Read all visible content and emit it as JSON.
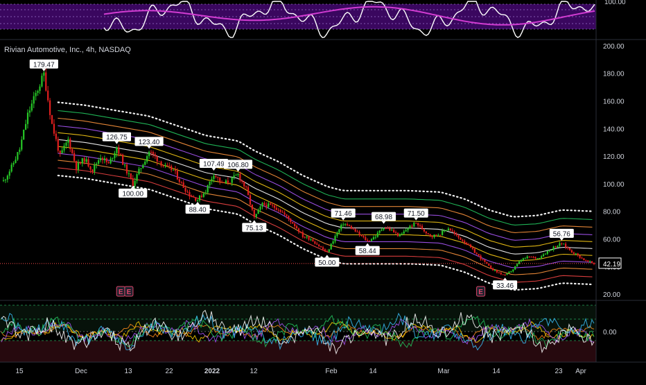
{
  "chart_title": "Rivian Automotive, Inc., 4h, NASDAQ",
  "colors": {
    "background": "#000000",
    "up": "#26c826",
    "down": "#e01e1e",
    "axis_text": "#d1d4dc",
    "price_line": "#ff4d4d",
    "oscillator_band": "#6a0dad",
    "oscillator_line": "#ffffff",
    "oscillator_signal": "#d23cd2",
    "envelope_colors": [
      "#ffffff",
      "#22c55e",
      "#fb923c",
      "#a855f7",
      "#facc15",
      "#ffffff",
      "#facc15",
      "#a855f7",
      "#fb923c",
      "#ef4444",
      "#ffffff"
    ]
  },
  "icons": {
    "earnings_marker": "earnings-e-icon"
  },
  "top_panel": {
    "label": "100.00"
  },
  "bottom_panel": {
    "label": "0.00"
  },
  "chart_data": {
    "type": "candlestick",
    "title": "Rivian Automotive, Inc., 4h, NASDAQ",
    "y_ticks": [
      20,
      40,
      60,
      80,
      100,
      120,
      140,
      160,
      180,
      200
    ],
    "y_tick_labels": [
      "20.00",
      "40.00",
      "60.00",
      "80.00",
      "100.00",
      "120.00",
      "140.00",
      "160.00",
      "180.00",
      "200.00"
    ],
    "ylim": [
      16,
      204
    ],
    "x_tick_labels": [
      "15",
      "Dec",
      "13",
      "22",
      "2022",
      "12",
      "Feb",
      "14",
      "Mar",
      "14",
      "23",
      "Apr"
    ],
    "last_price": "42.19",
    "close_path": [
      [
        0,
        102
      ],
      [
        4,
        112
      ],
      [
        8,
        125
      ],
      [
        12,
        150
      ],
      [
        16,
        165
      ],
      [
        20,
        179.47
      ],
      [
        24,
        143
      ],
      [
        28,
        120
      ],
      [
        32,
        132
      ],
      [
        36,
        112
      ],
      [
        40,
        118
      ],
      [
        44,
        110
      ],
      [
        48,
        120
      ],
      [
        52,
        114
      ],
      [
        56,
        126.75
      ],
      [
        60,
        112
      ],
      [
        64,
        100
      ],
      [
        68,
        112
      ],
      [
        72,
        123.4
      ],
      [
        76,
        118
      ],
      [
        80,
        112
      ],
      [
        84,
        110
      ],
      [
        88,
        100
      ],
      [
        92,
        92
      ],
      [
        96,
        88.4
      ],
      [
        100,
        95
      ],
      [
        104,
        107.49
      ],
      [
        108,
        100
      ],
      [
        112,
        102
      ],
      [
        116,
        106.8
      ],
      [
        120,
        96
      ],
      [
        124,
        75.13
      ],
      [
        128,
        85
      ],
      [
        132,
        84
      ],
      [
        136,
        82
      ],
      [
        140,
        76
      ],
      [
        144,
        70
      ],
      [
        148,
        62
      ],
      [
        152,
        60
      ],
      [
        156,
        55
      ],
      [
        160,
        50
      ],
      [
        164,
        62
      ],
      [
        168,
        71.46
      ],
      [
        172,
        68
      ],
      [
        176,
        63
      ],
      [
        180,
        58.44
      ],
      [
        184,
        62
      ],
      [
        188,
        68.98
      ],
      [
        192,
        66
      ],
      [
        196,
        62
      ],
      [
        200,
        68
      ],
      [
        204,
        71.5
      ],
      [
        208,
        66
      ],
      [
        212,
        62
      ],
      [
        216,
        64
      ],
      [
        220,
        68
      ],
      [
        224,
        62
      ],
      [
        228,
        58
      ],
      [
        232,
        52
      ],
      [
        236,
        46
      ],
      [
        240,
        40
      ],
      [
        244,
        36
      ],
      [
        248,
        33.46
      ],
      [
        252,
        38
      ],
      [
        256,
        45
      ],
      [
        260,
        47
      ],
      [
        264,
        46
      ],
      [
        268,
        50
      ],
      [
        272,
        54
      ],
      [
        276,
        56.76
      ],
      [
        280,
        52
      ],
      [
        284,
        48
      ],
      [
        288,
        44
      ],
      [
        292,
        42.19
      ]
    ],
    "labels": [
      {
        "text": "179.47",
        "i": 20,
        "price": 179.47,
        "pos": "above"
      },
      {
        "text": "126.75",
        "i": 56,
        "price": 126.75,
        "pos": "above"
      },
      {
        "text": "123.40",
        "i": 72,
        "price": 123.4,
        "pos": "above"
      },
      {
        "text": "100.00",
        "i": 64,
        "price": 100,
        "pos": "below"
      },
      {
        "text": "88.40",
        "i": 96,
        "price": 88.4,
        "pos": "below"
      },
      {
        "text": "107.49",
        "i": 104,
        "price": 107.49,
        "pos": "above"
      },
      {
        "text": "106.80",
        "i": 116,
        "price": 106.8,
        "pos": "above"
      },
      {
        "text": "75.13",
        "i": 124,
        "price": 75.13,
        "pos": "below"
      },
      {
        "text": "71.46",
        "i": 168,
        "price": 71.46,
        "pos": "above"
      },
      {
        "text": "50.00",
        "i": 160,
        "price": 50,
        "pos": "below"
      },
      {
        "text": "68.98",
        "i": 188,
        "price": 68.98,
        "pos": "above"
      },
      {
        "text": "58.44",
        "i": 180,
        "price": 58.44,
        "pos": "below"
      },
      {
        "text": "71.50",
        "i": 204,
        "price": 71.5,
        "pos": "above"
      },
      {
        "text": "33.46",
        "i": 248,
        "price": 33.46,
        "pos": "below"
      },
      {
        "text": "56.76",
        "i": 276,
        "price": 56.76,
        "pos": "above"
      }
    ],
    "envelope": {
      "center_path": [
        [
          0,
          0
        ],
        [
          10,
          0
        ],
        [
          20,
          0
        ],
        [
          27,
          128
        ],
        [
          40,
          126
        ],
        [
          56,
          122
        ],
        [
          72,
          118
        ],
        [
          84,
          112
        ],
        [
          100,
          104
        ],
        [
          116,
          100
        ],
        [
          124,
          93
        ],
        [
          136,
          85
        ],
        [
          148,
          75
        ],
        [
          160,
          67
        ],
        [
          168,
          64
        ],
        [
          200,
          64
        ],
        [
          216,
          63
        ],
        [
          228,
          58
        ],
        [
          240,
          50
        ],
        [
          252,
          45
        ],
        [
          264,
          46
        ],
        [
          276,
          50
        ],
        [
          292,
          49
        ]
      ],
      "offsets": [
        31,
        25,
        19.5,
        14,
        9,
        4,
        -1,
        -6,
        -11,
        -16.5,
        -22
      ]
    },
    "earnings_markers": [
      {
        "i": 58,
        "label": "E"
      },
      {
        "i": 62,
        "label": "E"
      },
      {
        "i": 236,
        "label": "E"
      }
    ]
  }
}
